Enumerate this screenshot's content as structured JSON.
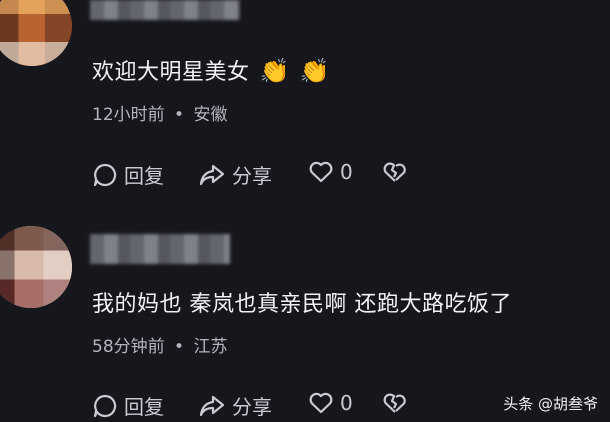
{
  "comments": [
    {
      "username": "",
      "text": "欢迎大明星美女",
      "emoji": [
        "👏",
        "👏"
      ],
      "time": "12小时前",
      "location": "安徽",
      "separator": "•",
      "reply_label": "回复",
      "share_label": "分享",
      "like_count": "0"
    },
    {
      "username": "",
      "text": "我的妈也 秦岚也真亲民啊 还跑大路吃饭了",
      "time": "58分钟前",
      "location": "江苏",
      "separator": "•",
      "reply_label": "回复",
      "share_label": "分享",
      "like_count": "0"
    }
  ],
  "watermark": "头条 @胡叁爷",
  "icons": [
    "comment-icon",
    "share-icon",
    "heart-icon",
    "broken-heart-icon"
  ],
  "colors": {
    "background": "#16171c",
    "text": "#f2f2f6",
    "meta": "#b3b4bd"
  }
}
